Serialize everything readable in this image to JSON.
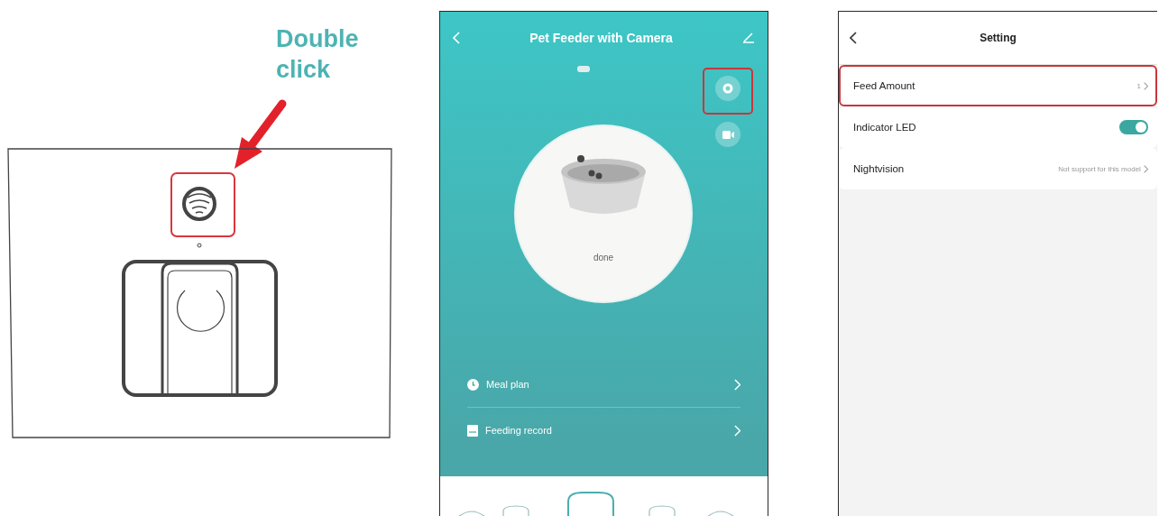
{
  "instruction": {
    "text": "Double click"
  },
  "feeder_screen": {
    "title": "Pet Feeder with Camera",
    "settings_highlighted": true,
    "status": "done",
    "menu": [
      {
        "label": "Meal plan"
      },
      {
        "label": "Feeding record"
      }
    ]
  },
  "settings_screen": {
    "title": "Setting",
    "rows": [
      {
        "kind": "link",
        "label": "Feed Amount",
        "value": "1",
        "highlighted": true
      },
      {
        "kind": "toggle",
        "label": "Indicator LED",
        "on": true,
        "highlighted": false
      },
      {
        "kind": "link",
        "label": "Nightvision",
        "value": "Not support for this model",
        "highlighted": false
      }
    ]
  }
}
